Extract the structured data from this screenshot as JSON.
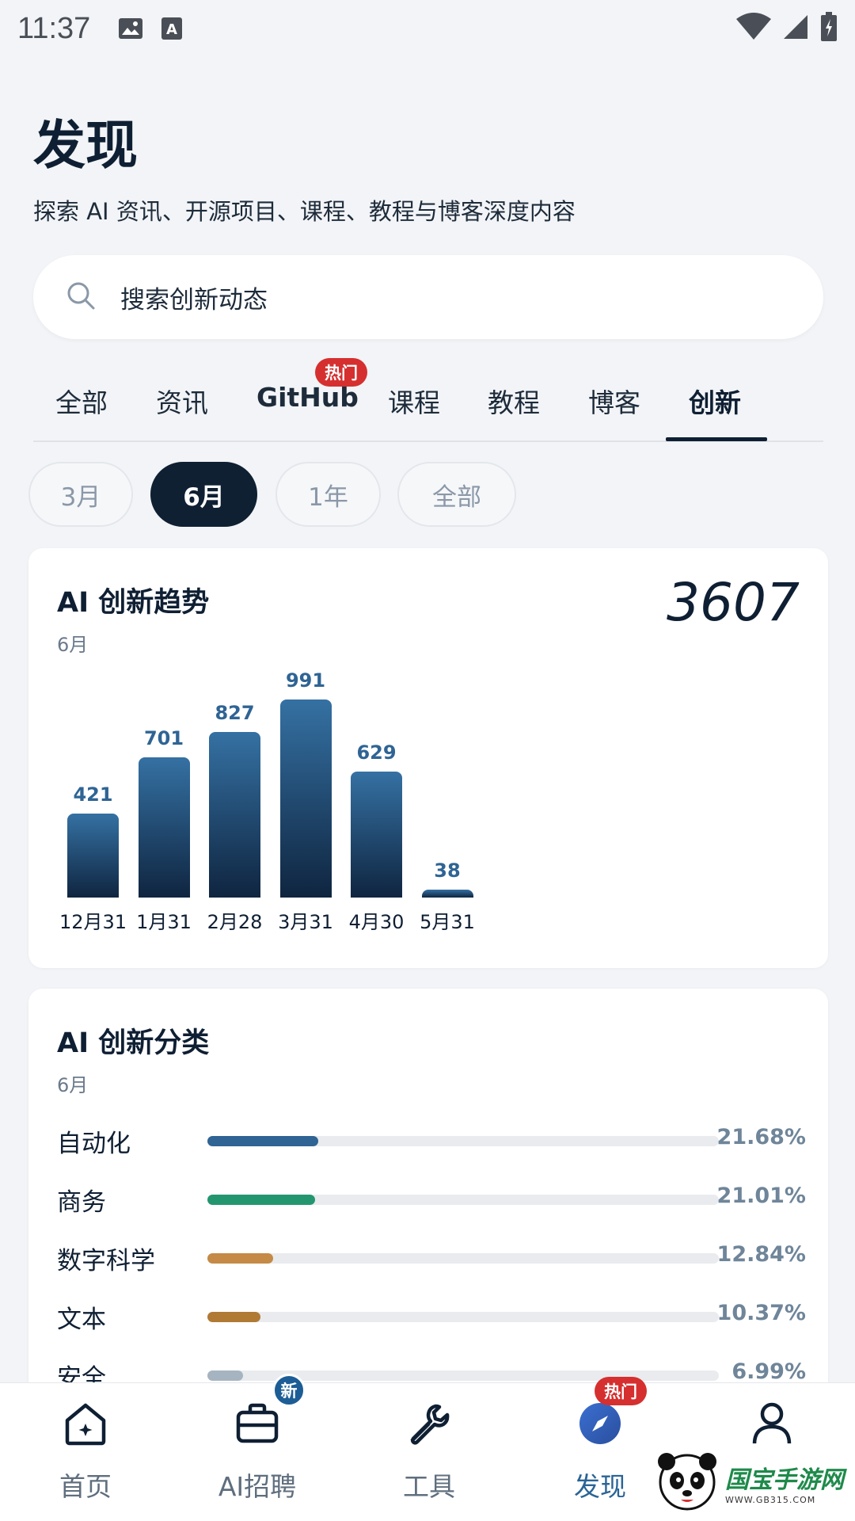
{
  "status_bar": {
    "time": "11:37"
  },
  "header": {
    "title": "发现",
    "subtitle": "探索 AI 资讯、开源项目、课程、教程与博客深度内容"
  },
  "search": {
    "placeholder": "搜索创新动态"
  },
  "tabs": [
    {
      "label": "全部"
    },
    {
      "label": "资讯"
    },
    {
      "label": "GitHub",
      "badge": "热门"
    },
    {
      "label": "课程"
    },
    {
      "label": "教程"
    },
    {
      "label": "博客"
    },
    {
      "label": "创新",
      "active": true
    }
  ],
  "period_chips": [
    {
      "label": "3月"
    },
    {
      "label": "6月",
      "active": true
    },
    {
      "label": "1年"
    },
    {
      "label": "全部"
    }
  ],
  "trend_card": {
    "title": "AI 创新趋势",
    "period": "6月",
    "total": "3607"
  },
  "chart_data": {
    "type": "bar",
    "categories": [
      "12月31",
      "1月31",
      "2月28",
      "3月31",
      "4月30",
      "5月31"
    ],
    "values": [
      421,
      701,
      827,
      991,
      629,
      38
    ]
  },
  "category_card": {
    "title": "AI 创新分类",
    "period": "6月",
    "items": [
      {
        "name": "自动化",
        "percent": "21.68%",
        "share": 21.68,
        "color": "#2f6494"
      },
      {
        "name": "商务",
        "percent": "21.01%",
        "share": 21.01,
        "color": "#23966f"
      },
      {
        "name": "数字科学",
        "percent": "12.84%",
        "share": 12.84,
        "color": "#c48a46"
      },
      {
        "name": "文本",
        "percent": "10.37%",
        "share": 10.37,
        "color": "#b07a35"
      },
      {
        "name": "安全",
        "percent": "6.99%",
        "share": 6.99,
        "color": "#a6b4c1"
      }
    ]
  },
  "bottom_nav": [
    {
      "label": "首页",
      "icon": "home-icon"
    },
    {
      "label": "AI招聘",
      "icon": "briefcase-icon",
      "badge": "新"
    },
    {
      "label": "工具",
      "icon": "wrench-icon"
    },
    {
      "label": "发现",
      "icon": "compass-icon",
      "badge": "热门",
      "active": true
    },
    {
      "label": "",
      "icon": "user-icon"
    }
  ],
  "watermark": {
    "text": "国宝手游网",
    "url_text": "WWW.GB315.COM"
  }
}
